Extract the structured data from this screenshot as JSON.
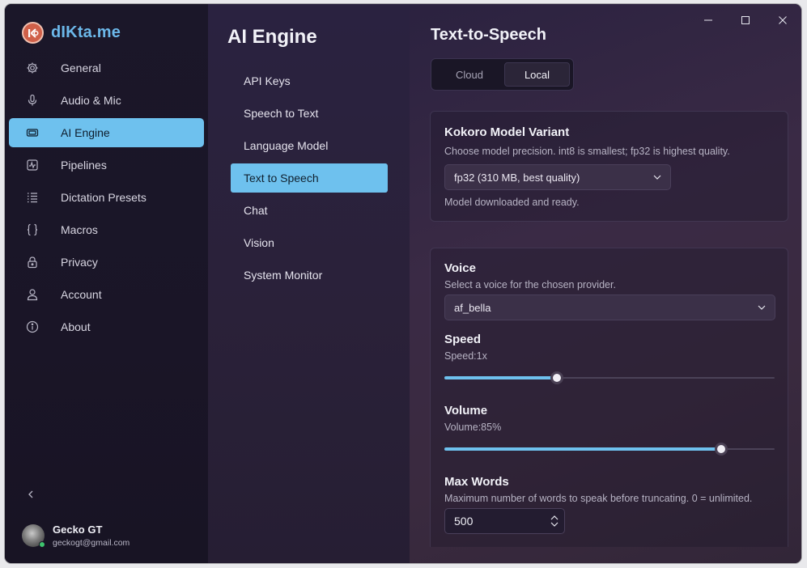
{
  "brand": {
    "name": "dIKta.me",
    "logo_text": "K"
  },
  "sidebar": {
    "items": [
      {
        "label": "General",
        "icon": "gear-icon"
      },
      {
        "label": "Audio & Mic",
        "icon": "microphone-icon"
      },
      {
        "label": "AI Engine",
        "icon": "chip-icon",
        "active": true
      },
      {
        "label": "Pipelines",
        "icon": "pulse-icon"
      },
      {
        "label": "Dictation Presets",
        "icon": "list-icon"
      },
      {
        "label": "Macros",
        "icon": "braces-icon"
      },
      {
        "label": "Privacy",
        "icon": "lock-icon"
      },
      {
        "label": "Account",
        "icon": "person-icon"
      },
      {
        "label": "About",
        "icon": "info-icon"
      }
    ]
  },
  "user": {
    "name": "Gecko GT",
    "email": "geckogt@gmail.com"
  },
  "section": {
    "title": "AI Engine",
    "items": [
      {
        "label": "API Keys"
      },
      {
        "label": "Speech to Text"
      },
      {
        "label": "Language Model"
      },
      {
        "label": "Text to Speech",
        "active": true
      },
      {
        "label": "Chat"
      },
      {
        "label": "Vision"
      },
      {
        "label": "System Monitor"
      }
    ]
  },
  "page": {
    "title": "Text-to-Speech",
    "provider_tabs": {
      "cloud": "Cloud",
      "local": "Local",
      "selected": "Local"
    },
    "model": {
      "heading": "Kokoro Model Variant",
      "description": "Choose model precision. int8 is smallest; fp32 is highest quality.",
      "selected": "fp32 (310 MB, best quality)",
      "status": "Model downloaded and ready."
    },
    "voice": {
      "heading": "Voice",
      "description": "Select a voice for the chosen provider.",
      "selected": "af_bella"
    },
    "speed": {
      "heading": "Speed",
      "readout": "Speed:1x",
      "fraction": 0.34
    },
    "volume": {
      "heading": "Volume",
      "readout": "Volume:85%",
      "fraction": 0.838
    },
    "max_words": {
      "heading": "Max Words",
      "description": "Maximum number of words to speak before truncating. 0 = unlimited.",
      "value": "500"
    }
  },
  "colors": {
    "accent": "#6ec1ee",
    "brand": "#6cb8ea",
    "logo": "#d06049"
  }
}
